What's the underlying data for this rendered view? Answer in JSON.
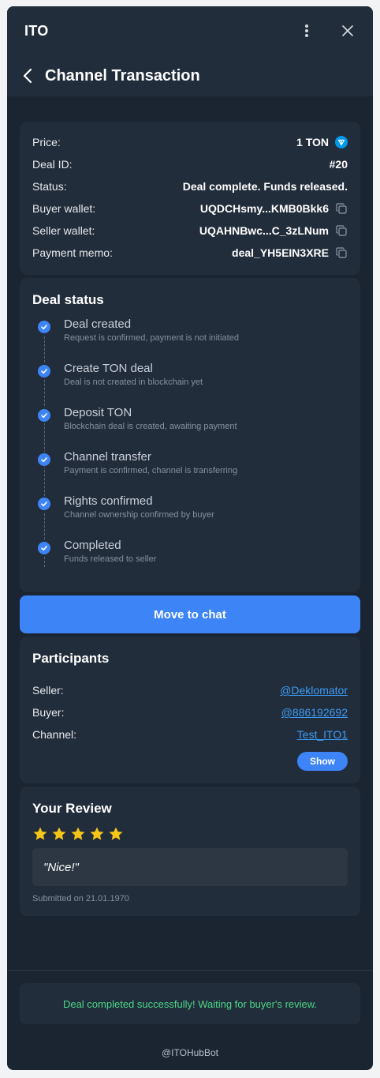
{
  "app": {
    "title": "ITO"
  },
  "nav": {
    "title": "Channel Transaction"
  },
  "deal": {
    "price_label": "Price:",
    "price_value": "1 TON",
    "id_label": "Deal ID:",
    "id_value": "#20",
    "status_label": "Status:",
    "status_value": "Deal complete. Funds released.",
    "buyer_wallet_label": "Buyer wallet:",
    "buyer_wallet_value": "UQDCHsmy...KMB0Bkk6",
    "seller_wallet_label": "Seller wallet:",
    "seller_wallet_value": "UQAHNBwc...C_3zLNum",
    "memo_label": "Payment memo:",
    "memo_value": "deal_YH5EIN3XRE"
  },
  "deal_status": {
    "title": "Deal status",
    "steps": [
      {
        "title": "Deal created",
        "desc": "Request is confirmed, payment is not initiated"
      },
      {
        "title": "Create TON deal",
        "desc": "Deal is not created in blockchain yet"
      },
      {
        "title": "Deposit TON",
        "desc": "Blockchain deal is created, awaiting payment"
      },
      {
        "title": "Channel transfer",
        "desc": "Payment is confirmed, channel is transferring"
      },
      {
        "title": "Rights confirmed",
        "desc": "Channel ownership confirmed by buyer"
      },
      {
        "title": "Completed",
        "desc": "Funds released to seller"
      }
    ]
  },
  "actions": {
    "move_to_chat": "Move to chat"
  },
  "participants": {
    "title": "Participants",
    "seller_label": "Seller:",
    "seller_value": "@Deklomator",
    "buyer_label": "Buyer:",
    "buyer_value": "@886192692",
    "channel_label": "Channel:",
    "channel_value": "Test_ITO1",
    "show_label": "Show"
  },
  "review": {
    "title": "Your Review",
    "rating": 5,
    "text": "\"Nice!\"",
    "submitted": "Submitted on 21.01.1970",
    "star_color": "#f5c518"
  },
  "banner": {
    "text": "Deal completed successfully! Waiting for buyer's review."
  },
  "footer": {
    "bot": "@ITOHubBot"
  },
  "colors": {
    "accent": "#3d84f7",
    "success": "#4cd787",
    "link": "#3d9bf5",
    "ton": "#0098ea"
  }
}
